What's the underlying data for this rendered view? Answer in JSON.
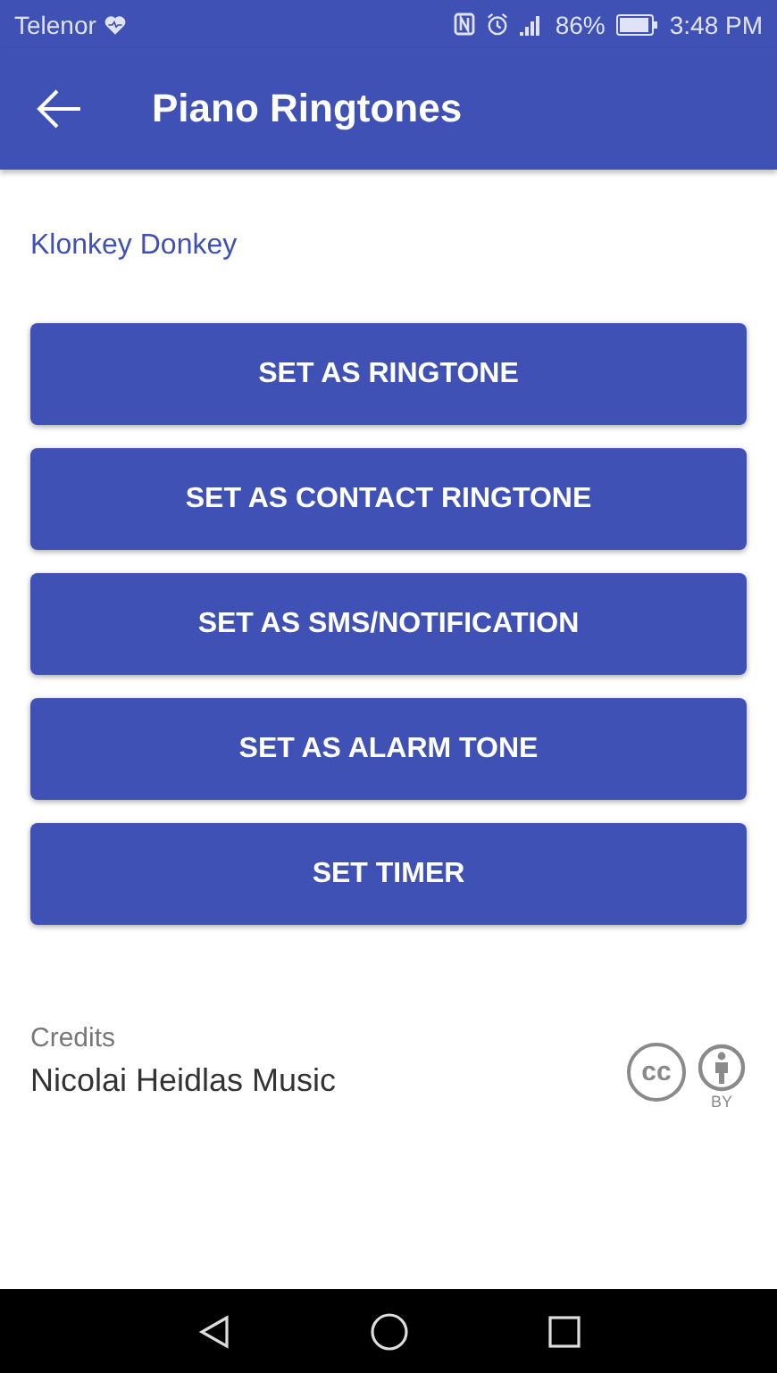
{
  "status_bar": {
    "carrier": "Telenor",
    "battery": "86%",
    "time": "3:48 PM"
  },
  "app_bar": {
    "title": "Piano Ringtones"
  },
  "ringtone_name": "Klonkey Donkey",
  "buttons": [
    "SET AS RINGTONE",
    "SET AS CONTACT RINGTONE",
    "SET AS SMS/NOTIFICATION",
    "SET AS ALARM TONE",
    "SET TIMER"
  ],
  "credits": {
    "label": "Credits",
    "author": "Nicolai Heidlas Music",
    "cc_mark": "cc",
    "by_mark": "BY"
  }
}
